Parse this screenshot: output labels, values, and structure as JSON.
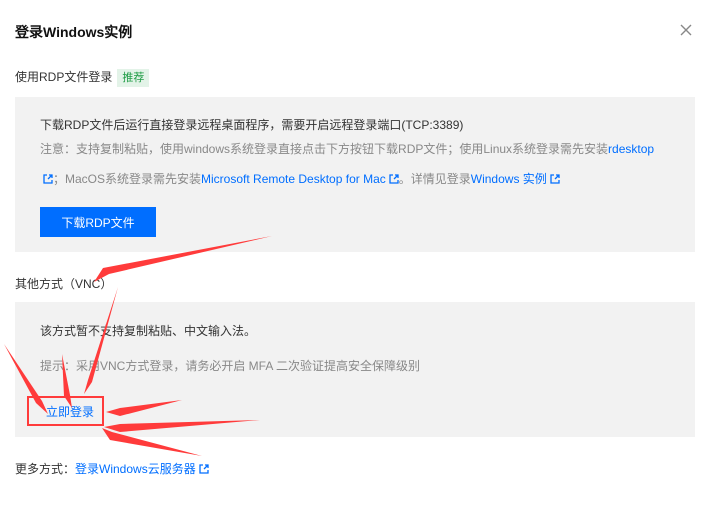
{
  "dialog": {
    "title": "登录Windows实例"
  },
  "rdp": {
    "label": "使用RDP文件登录",
    "tag": "推荐",
    "description": "下载RDP文件后运行直接登录远程桌面程序，需要开启远程登录端口(TCP:3389)",
    "note_prefix": "注意：支持复制粘贴，使用windows系统登录直接点击下方按钮下载RDP文件；使用Linux系统登录需先安装",
    "note_link_rdesktop": "rdesktop",
    "note_mid": "；MacOS系统登录需先安装",
    "note_link_mac": "Microsoft Remote Desktop for Mac",
    "note_mid2": "。详情见登录",
    "note_link_windows": "Windows 实例",
    "download_button": "下载RDP文件"
  },
  "vnc": {
    "label": "其他方式（VNC）",
    "notice": "该方式暂不支持复制粘贴、中文输入法。",
    "tip": "提示：采用VNC方式登录，请务必开启 MFA 二次验证提高安全保障级别",
    "login_link": "立即登录"
  },
  "footer": {
    "label": "更多方式：",
    "link": "登录Windows云服务器"
  },
  "colors": {
    "accent": "#006eff",
    "annotation": "#ff3b3b",
    "tag_bg": "#e3f3e8",
    "tag_text": "#1f9c45",
    "panel_bg": "#f2f2f2"
  },
  "icons": [
    "close-icon",
    "external-link-icon"
  ]
}
